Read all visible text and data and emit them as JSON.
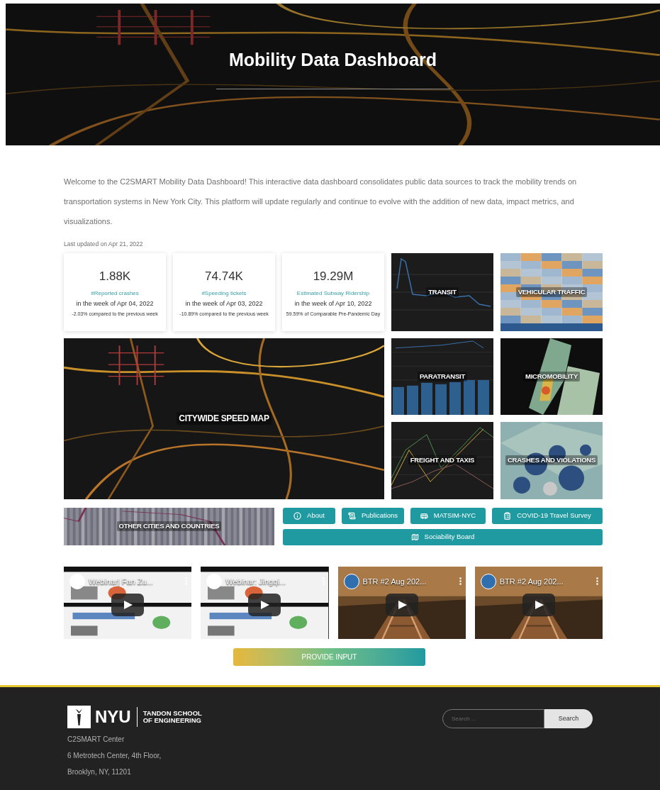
{
  "header": {
    "title": "Mobility Data Dashboard"
  },
  "intro": "Welcome to the C2SMART Mobility Data Dashboard! This interactive data dashboard consolidates public data sources to track the mobility trends on transportation systems in New York City. This platform will update regularly and continue to evolve with the addition of new data, impact metrics, and visualizations.",
  "last_updated": "Last updated on Apr 21, 2022",
  "stats": [
    {
      "value": "1.88K",
      "label": "#Reported crashes",
      "period": "in the week of Apr 04, 2022",
      "note": "-2.03% compared to the previous week"
    },
    {
      "value": "74.74K",
      "label": "#Speeding tickets",
      "period": "in the week of Apr 03, 2022",
      "note": "-10.89% compared to the previous week"
    },
    {
      "value": "19.29M",
      "label": "Estimated Subway Ridership",
      "period": "in the week of Apr 10, 2022",
      "note": "59.59% of Comparable Pre-Pandemic Day"
    }
  ],
  "tiles": [
    {
      "label": "TRANSIT",
      "kind": "line"
    },
    {
      "label": "VEHICULAR TRAFFIC",
      "kind": "heatmap"
    },
    {
      "label": "CITYWIDE SPEED MAP",
      "kind": "citymap"
    },
    {
      "label": "PARATRANSIT",
      "kind": "bars"
    },
    {
      "label": "MICROMOBILITY",
      "kind": "density"
    },
    {
      "label": "FREIGHT AND TAXIS",
      "kind": "multiline"
    },
    {
      "label": "CRASHES AND VIOLATIONS",
      "kind": "dots"
    },
    {
      "label": "OTHER CITIES AND COUNTRIES",
      "kind": "stripes"
    }
  ],
  "buttons": [
    {
      "label": "About"
    },
    {
      "label": "Publications"
    },
    {
      "label": "MATSIM-NYC"
    },
    {
      "label": "COVID-19 Travel Survey"
    },
    {
      "label": "Sociability Board"
    }
  ],
  "videos": [
    {
      "title": "Webinar| Fan Zu...",
      "kind": "slides"
    },
    {
      "title": "Webinar: Jingqi...",
      "kind": "slides"
    },
    {
      "title": "BTR #2 Aug 202...",
      "kind": "rails"
    },
    {
      "title": "BTR #2 Aug 202...",
      "kind": "rails"
    }
  ],
  "provide_input": "PROVIDE INPUT",
  "footer": {
    "logo_name": "NYU",
    "logo_school": "TANDON SCHOOL",
    "logo_school_2": "OF ENGINEERING",
    "address": [
      "C2SMART Center",
      "6 Metrotech Center, 4th Floor,",
      "Brooklyn, NY, 11201"
    ],
    "search_placeholder": "Search ...",
    "search_button": "Search"
  }
}
